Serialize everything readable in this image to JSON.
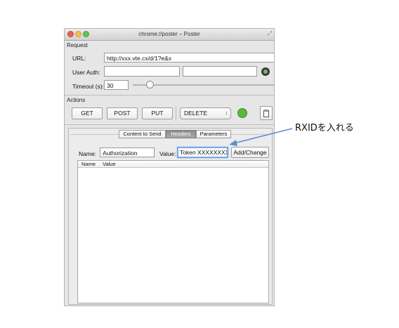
{
  "window": {
    "title": "chrome://poster – Poster"
  },
  "request": {
    "section_label": "Request",
    "url_label": "URL:",
    "url_value": "http://xxx.vte.cx/d/1?e&x",
    "user_auth_label": "User Auth:",
    "user_auth_user": "",
    "user_auth_pass": "",
    "timeout_label": "Timeout (s):",
    "timeout_value": "30",
    "timeout_slider_level": 0.12
  },
  "actions": {
    "section_label": "Actions",
    "get_label": "GET",
    "post_label": "POST",
    "put_label": "PUT",
    "method_select_value": "DELETE",
    "status_color": "#56b83d"
  },
  "tabs": {
    "content_to_send": "Content to Send",
    "headers": "Headers",
    "parameters": "Parameters",
    "selected": "Headers"
  },
  "headers": {
    "name_label": "Name:",
    "name_value": "Authorization",
    "value_label": "Value:",
    "value_value": "Token XXXXXXXX)",
    "add_change_label": "Add/Change",
    "table_columns": [
      "Name",
      "Value"
    ]
  },
  "annotation": {
    "text": "RXIDを入れる",
    "color": "#5b8fd0"
  }
}
